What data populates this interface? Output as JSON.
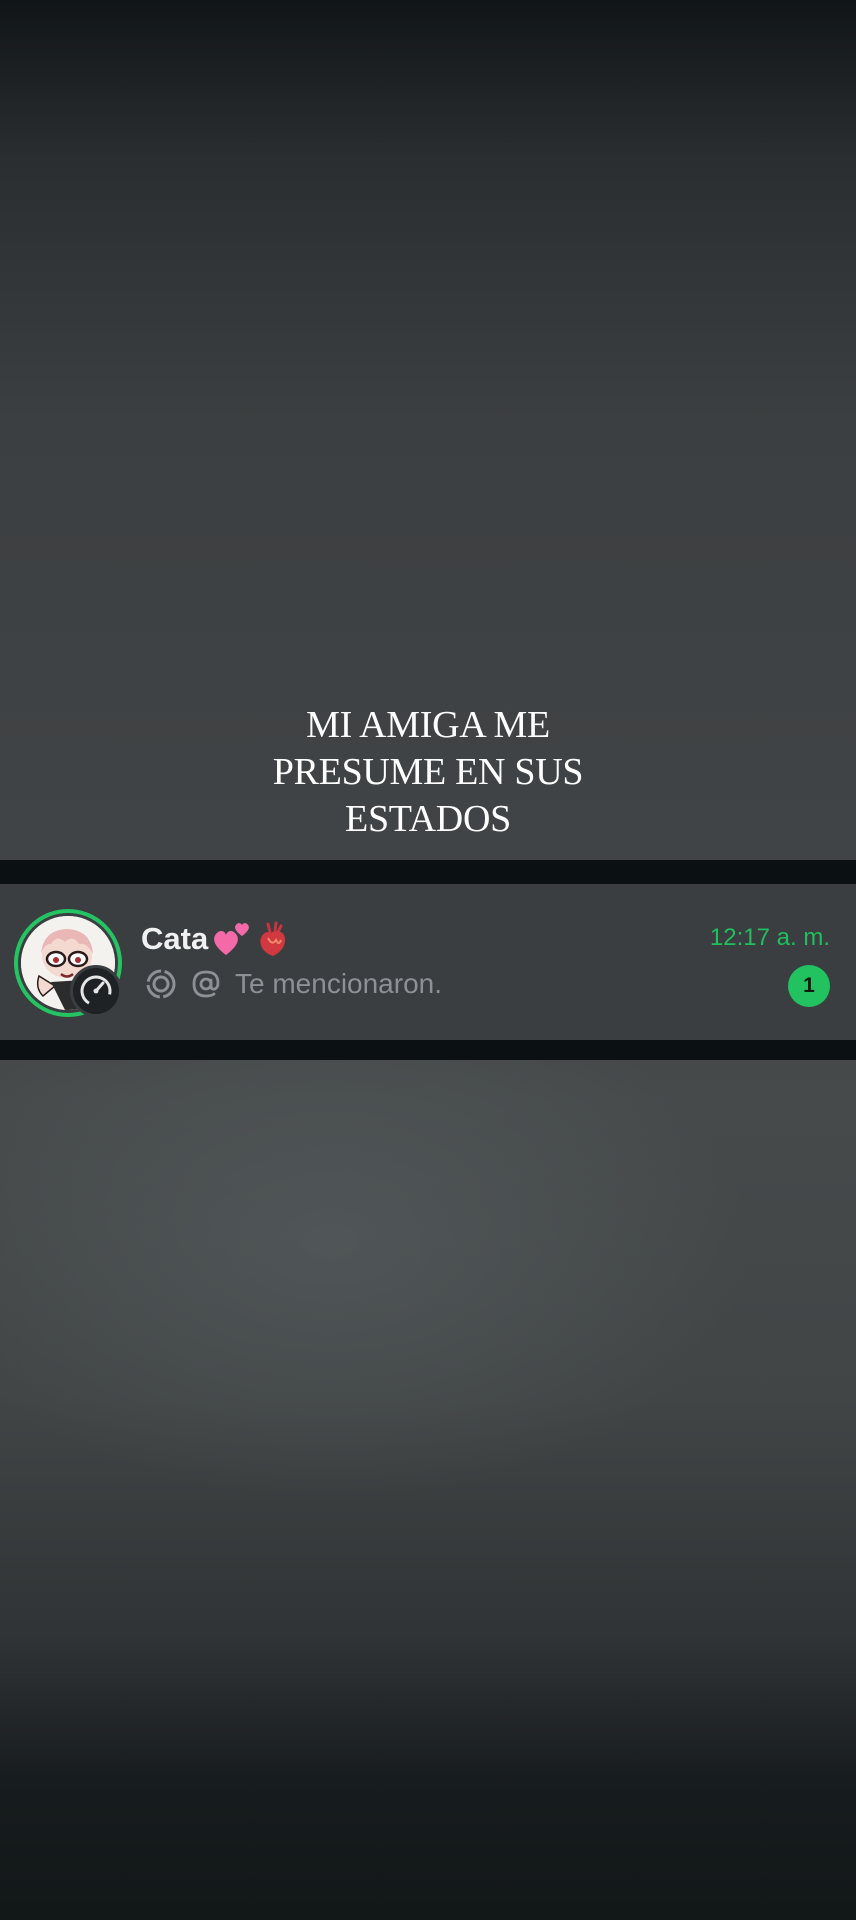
{
  "caption": {
    "line1": "MI AMIGA ME",
    "line2": "PRESUME EN SUS",
    "line3": "ESTADOS"
  },
  "chat": {
    "contact_name": "Cata",
    "name_emojis": [
      "two-hearts-icon",
      "anatomical-heart-icon"
    ],
    "preview_text": "Te mencionaron.",
    "preview_icons": [
      "status-ring-icon",
      "at-mention-icon"
    ],
    "time": "12:17 a. m.",
    "unread_count": "1"
  },
  "colors": {
    "accent_green": "#25c463",
    "time_green": "#1fbf5d",
    "row_background": "#3a3e41",
    "name_text": "#f1f1f1",
    "preview_text": "#8c9195"
  }
}
